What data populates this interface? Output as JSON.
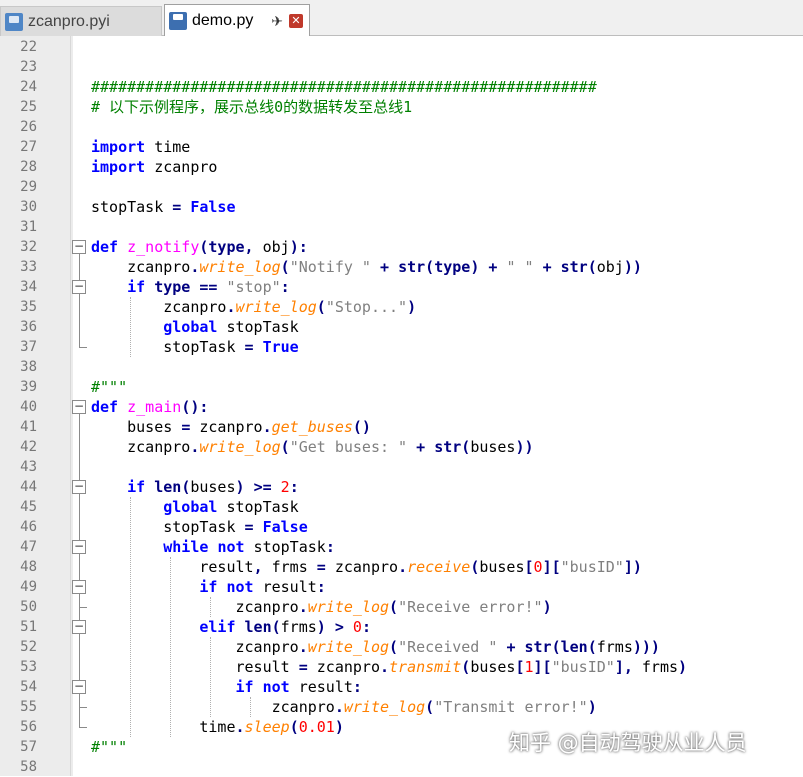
{
  "tabs": [
    {
      "label": "zcanpro.pyi",
      "active": false
    },
    {
      "label": "demo.py",
      "active": true
    }
  ],
  "icons": {
    "pin": "pin-icon",
    "close": "close-icon"
  },
  "lines": [
    {
      "n": "22",
      "html": ""
    },
    {
      "n": "23",
      "html": ""
    },
    {
      "n": "24",
      "html": "<span class=\"cm\">########################################################</span>"
    },
    {
      "n": "25",
      "html": "<span class=\"cm\"># 以下示例程序，展示总线0的数据转发至总线1</span>"
    },
    {
      "n": "26",
      "html": ""
    },
    {
      "n": "27",
      "html": "<span class=\"kw\">import</span> time"
    },
    {
      "n": "28",
      "html": "<span class=\"kw\">import</span> zcanpro"
    },
    {
      "n": "29",
      "html": ""
    },
    {
      "n": "30",
      "html": "stopTask <span class=\"op\">=</span> <span class=\"kw\">False</span>"
    },
    {
      "n": "31",
      "html": ""
    },
    {
      "n": "32",
      "html": "<span class=\"kw\">def</span> <span class=\"fn\">z_notify</span><span class=\"op\">(</span><span class=\"bi\">type</span><span class=\"op\">,</span> obj<span class=\"op\">):</span>"
    },
    {
      "n": "33",
      "html": "    zcanpro<span class=\"op\">.</span><span class=\"meth\">write_log</span><span class=\"op\">(</span><span class=\"str\">\"Notify \"</span> <span class=\"op\">+</span> <span class=\"bi\">str</span><span class=\"op\">(</span><span class=\"bi\">type</span><span class=\"op\">)</span> <span class=\"op\">+</span> <span class=\"str\">\" \"</span> <span class=\"op\">+</span> <span class=\"bi\">str</span><span class=\"op\">(</span>obj<span class=\"op\">))</span>"
    },
    {
      "n": "34",
      "html": "    <span class=\"kw\">if</span> <span class=\"bi\">type</span> <span class=\"op\">==</span> <span class=\"str\">\"stop\"</span><span class=\"op\">:</span>"
    },
    {
      "n": "35",
      "html": "        zcanpro<span class=\"op\">.</span><span class=\"meth\">write_log</span><span class=\"op\">(</span><span class=\"str\">\"Stop...\"</span><span class=\"op\">)</span>"
    },
    {
      "n": "36",
      "html": "        <span class=\"kw\">global</span> stopTask"
    },
    {
      "n": "37",
      "html": "        stopTask <span class=\"op\">=</span> <span class=\"kw\">True</span>"
    },
    {
      "n": "38",
      "html": ""
    },
    {
      "n": "39",
      "html": "<span class=\"cm\">#\"\"\"</span>"
    },
    {
      "n": "40",
      "html": "<span class=\"kw\">def</span> <span class=\"fn\">z_main</span><span class=\"op\">():</span>"
    },
    {
      "n": "41",
      "html": "    buses <span class=\"op\">=</span> zcanpro<span class=\"op\">.</span><span class=\"meth\">get_buses</span><span class=\"op\">()</span>"
    },
    {
      "n": "42",
      "html": "    zcanpro<span class=\"op\">.</span><span class=\"meth\">write_log</span><span class=\"op\">(</span><span class=\"str\">\"Get buses: \"</span> <span class=\"op\">+</span> <span class=\"bi\">str</span><span class=\"op\">(</span>buses<span class=\"op\">))</span>"
    },
    {
      "n": "43",
      "html": ""
    },
    {
      "n": "44",
      "html": "    <span class=\"kw\">if</span> <span class=\"bi\">len</span><span class=\"op\">(</span>buses<span class=\"op\">)</span> <span class=\"op\">>=</span> <span class=\"num\">2</span><span class=\"op\">:</span>"
    },
    {
      "n": "45",
      "html": "        <span class=\"kw\">global</span> stopTask"
    },
    {
      "n": "46",
      "html": "        stopTask <span class=\"op\">=</span> <span class=\"kw\">False</span>"
    },
    {
      "n": "47",
      "html": "        <span class=\"kw\">while</span> <span class=\"kw\">not</span> stopTask<span class=\"op\">:</span>"
    },
    {
      "n": "48",
      "html": "            result<span class=\"op\">,</span> frms <span class=\"op\">=</span> zcanpro<span class=\"op\">.</span><span class=\"meth\">receive</span><span class=\"op\">(</span>buses<span class=\"op\">[</span><span class=\"num\">0</span><span class=\"op\">][</span><span class=\"str\">\"busID\"</span><span class=\"op\">])</span>"
    },
    {
      "n": "49",
      "html": "            <span class=\"kw\">if</span> <span class=\"kw\">not</span> result<span class=\"op\">:</span>"
    },
    {
      "n": "50",
      "html": "                zcanpro<span class=\"op\">.</span><span class=\"meth\">write_log</span><span class=\"op\">(</span><span class=\"str\">\"Receive error!\"</span><span class=\"op\">)</span>"
    },
    {
      "n": "51",
      "html": "            <span class=\"kw\">elif</span> <span class=\"bi\">len</span><span class=\"op\">(</span>frms<span class=\"op\">)</span> <span class=\"op\">></span> <span class=\"num\">0</span><span class=\"op\">:</span>"
    },
    {
      "n": "52",
      "html": "                zcanpro<span class=\"op\">.</span><span class=\"meth\">write_log</span><span class=\"op\">(</span><span class=\"str\">\"Received \"</span> <span class=\"op\">+</span> <span class=\"bi\">str</span><span class=\"op\">(</span><span class=\"bi\">len</span><span class=\"op\">(</span>frms<span class=\"op\">)))</span>"
    },
    {
      "n": "53",
      "html": "                result <span class=\"op\">=</span> zcanpro<span class=\"op\">.</span><span class=\"meth\">transmit</span><span class=\"op\">(</span>buses<span class=\"op\">[</span><span class=\"num\">1</span><span class=\"op\">][</span><span class=\"str\">\"busID\"</span><span class=\"op\">],</span> frms<span class=\"op\">)</span>"
    },
    {
      "n": "54",
      "html": "                <span class=\"kw\">if</span> <span class=\"kw\">not</span> result<span class=\"op\">:</span>"
    },
    {
      "n": "55",
      "html": "                    zcanpro<span class=\"op\">.</span><span class=\"meth\">write_log</span><span class=\"op\">(</span><span class=\"str\">\"Transmit error!\"</span><span class=\"op\">)</span>"
    },
    {
      "n": "56",
      "html": "            time<span class=\"op\">.</span><span class=\"meth\">sleep</span><span class=\"op\">(</span><span class=\"num\">0.01</span><span class=\"op\">)</span>"
    },
    {
      "n": "57",
      "html": "<span class=\"cm\">#\"\"\"</span>"
    },
    {
      "n": "58",
      "html": ""
    }
  ],
  "folds": [
    "32",
    "34",
    "40",
    "44",
    "47",
    "49",
    "51",
    "54"
  ],
  "watermark": "知乎 @自动驾驶从业人员"
}
